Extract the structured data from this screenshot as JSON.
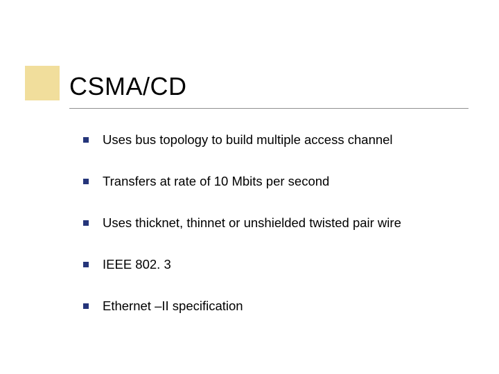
{
  "title": "CSMA/CD",
  "bullets": [
    "Uses bus topology to build multiple access channel",
    "Transfers at rate of 10 Mbits per second",
    "Uses thicknet, thinnet or unshielded twisted pair wire",
    "IEEE 802. 3",
    "Ethernet –II specification"
  ],
  "colors": {
    "accent_box": "#e6c24a",
    "bullet_marker": "#25357a"
  }
}
